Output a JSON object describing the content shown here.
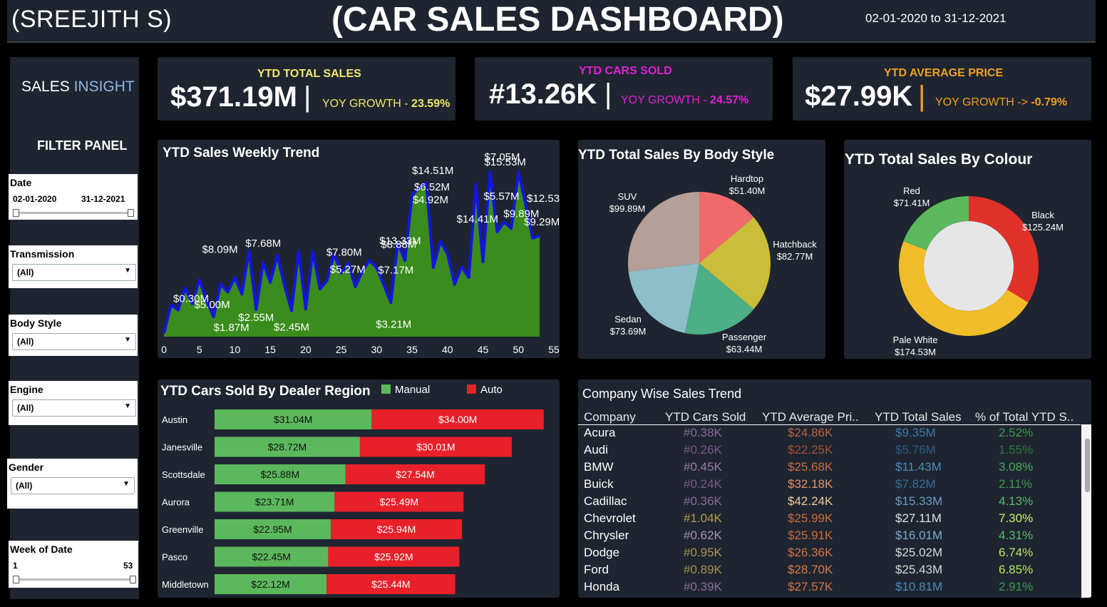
{
  "header": {
    "author": "(SREEJITH S)",
    "title": "(CAR SALES DASHBOARD)",
    "date_range": "02-01-2020 to 31-12-2021"
  },
  "sidebar": {
    "sales_word": "SALES",
    "insight_word": "INSIGHT",
    "filter_title": "FILTER PANEL",
    "filters": {
      "date": {
        "label": "Date",
        "from": "02-01-2020",
        "to": "31-12-2021"
      },
      "transmission": {
        "label": "Transmission",
        "value": "(All)"
      },
      "body_style": {
        "label": "Body Style",
        "value": "(All)"
      },
      "engine": {
        "label": "Engine",
        "value": "(All)"
      },
      "gender": {
        "label": "Gender",
        "value": "(All)"
      },
      "week": {
        "label": "Week of Date",
        "from": "1",
        "to": "53"
      }
    }
  },
  "kpis": [
    {
      "label": "YTD TOTAL SALES",
      "value": "$371.19M",
      "growth_label": "YOY GROWTH -",
      "growth_value": "23.59%",
      "color": "#f2e76b"
    },
    {
      "label": "YTD CARS SOLD",
      "value": "#13.26K",
      "growth_label": "YOY GROWTH -",
      "growth_value": "24.57%",
      "color": "#e020d8"
    },
    {
      "label": "YTD AVERAGE PRICE",
      "value": "$27.99K",
      "growth_label": "YOY GROWTH ->",
      "growth_value": "-0.79%",
      "color": "#f0a020"
    }
  ],
  "weekly_trend": {
    "title": "YTD Sales Weekly Trend",
    "x_ticks": [
      "0",
      "5",
      "10",
      "15",
      "20",
      "25",
      "30",
      "35",
      "40",
      "45",
      "50",
      "55"
    ],
    "labels": [
      {
        "text": "$0.30M",
        "week": 1
      },
      {
        "text": "$1.87M",
        "week": 7
      },
      {
        "text": "$5.00M",
        "week": 7
      },
      {
        "text": "$8.09M",
        "week": 8
      },
      {
        "text": "$2.55M",
        "week": 13
      },
      {
        "text": "$7.68M",
        "week": 14
      },
      {
        "text": "$2.45M",
        "week": 18
      },
      {
        "text": "$5.27M",
        "week": 23
      },
      {
        "text": "$7.80M",
        "week": 23
      },
      {
        "text": "$3.21M",
        "week": 32
      },
      {
        "text": "$7.17M",
        "week": 32
      },
      {
        "text": "$8.88M",
        "week": 32
      },
      {
        "text": "$13.33M",
        "week": 32
      },
      {
        "text": "$14.51M",
        "week": 37
      },
      {
        "text": "$6.52M",
        "week": 37
      },
      {
        "text": "$4.92M",
        "week": 37
      },
      {
        "text": "$14.41M",
        "week": 43
      },
      {
        "text": "$7.05M",
        "week": 46
      },
      {
        "text": "$5.57M",
        "week": 46
      },
      {
        "text": "$15.53M",
        "week": 46
      },
      {
        "text": "$9.89M",
        "week": 48
      },
      {
        "text": "$12.53M",
        "week": 52
      },
      {
        "text": "$9.29M",
        "week": 52
      }
    ]
  },
  "chart_data": [
    {
      "type": "area",
      "title": "YTD Sales Weekly Trend",
      "x": [
        0,
        1,
        2,
        3,
        4,
        5,
        6,
        7,
        8,
        9,
        10,
        11,
        12,
        13,
        14,
        15,
        16,
        17,
        18,
        19,
        20,
        21,
        22,
        23,
        24,
        25,
        26,
        27,
        28,
        29,
        30,
        31,
        32,
        33,
        34,
        35,
        36,
        37,
        38,
        39,
        40,
        41,
        42,
        43,
        44,
        45,
        46,
        47,
        48,
        49,
        50,
        51,
        52,
        53
      ],
      "values": [
        0.3,
        3.0,
        2.5,
        4.6,
        3.1,
        5.4,
        3.4,
        1.87,
        5.0,
        4.2,
        5.6,
        4.0,
        8.09,
        2.55,
        7.0,
        5.1,
        7.68,
        4.8,
        2.45,
        8.1,
        2.6,
        8.0,
        4.5,
        5.27,
        7.8,
        6.0,
        6.9,
        4.7,
        6.2,
        7.17,
        6.5,
        4.9,
        3.21,
        8.88,
        7.17,
        13.33,
        14.0,
        14.51,
        6.52,
        9.0,
        7.8,
        4.92,
        6.6,
        5.57,
        14.41,
        7.05,
        15.53,
        9.89,
        10.8,
        10.2,
        15.53,
        12.53,
        9.29,
        9.5
      ],
      "xlim": [
        0,
        55
      ],
      "ylim": [
        0,
        16
      ],
      "xlabel": "",
      "ylabel": "",
      "color": "#3a8c1c",
      "line_color": "#1414e0"
    },
    {
      "type": "pie",
      "title": "YTD Total Sales By Body Style",
      "categories": [
        "Hardtop",
        "Hatchback",
        "Passenger",
        "Sedan",
        "SUV"
      ],
      "values": [
        51.4,
        82.77,
        63.44,
        73.69,
        99.89
      ],
      "labels": [
        "$51.40M",
        "$82.77M",
        "$63.44M",
        "$73.69M",
        "$99.89M"
      ],
      "colors": [
        "#ef6b6b",
        "#c9bd3a",
        "#4caf86",
        "#8dbfca",
        "#b59f96"
      ]
    },
    {
      "type": "pie",
      "title": "YTD Total Sales By Colour",
      "categories": [
        "Black",
        "Pale White",
        "Red"
      ],
      "values": [
        125.24,
        174.53,
        71.41
      ],
      "labels": [
        "$125.24M",
        "$174.53M",
        "$71.41M"
      ],
      "colors": [
        "#e0302a",
        "#f0bd28",
        "#5cb85c"
      ]
    },
    {
      "type": "bar",
      "title": "YTD Cars Sold By Dealer Region",
      "categories": [
        "Austin",
        "Janesville",
        "Scottsdale",
        "Aurora",
        "Greenville",
        "Pasco",
        "Middletown"
      ],
      "series": [
        {
          "name": "Manual",
          "values": [
            31.04,
            28.72,
            25.88,
            23.71,
            22.95,
            22.45,
            22.12
          ],
          "labels": [
            "$31.04M",
            "$28.72M",
            "$25.88M",
            "$23.71M",
            "$22.95M",
            "$22.45M",
            "$22.12M"
          ],
          "color": "#5cb85c"
        },
        {
          "name": "Auto",
          "values": [
            34.0,
            30.01,
            27.54,
            25.49,
            25.94,
            25.92,
            25.44
          ],
          "labels": [
            "$34.00M",
            "$30.01M",
            "$27.54M",
            "$25.49M",
            "$25.94M",
            "$25.92M",
            "$25.44M"
          ],
          "color": "#e8202a"
        }
      ]
    }
  ],
  "company_table": {
    "title": "Company Wise Sales Trend",
    "columns": [
      "Company",
      "YTD Cars Sold",
      "YTD Average Pri..",
      "YTD Total Sales",
      "% of Total YTD S.."
    ],
    "rows": [
      {
        "company": "Acura",
        "sold": "#0.38K",
        "avg": "$24.86K",
        "total": "$9.35M",
        "pct": "2.52%",
        "c_sold": "#8a6a9a",
        "c_avg": "#c06038",
        "c_total": "#3d7aa8",
        "c_pct": "#3a9a4a"
      },
      {
        "company": "Audi",
        "sold": "#0.26K",
        "avg": "$22.25K",
        "total": "$5.76M",
        "pct": "1.55%",
        "c_sold": "#7a5a8a",
        "c_avg": "#a85030",
        "c_total": "#2d5a88",
        "c_pct": "#2a7a3a"
      },
      {
        "company": "BMW",
        "sold": "#0.45K",
        "avg": "$25.68K",
        "total": "$11.43M",
        "pct": "3.08%",
        "c_sold": "#9a78aa",
        "c_avg": "#d06838",
        "c_total": "#4a8ab8",
        "c_pct": "#4aaa5a"
      },
      {
        "company": "Buick",
        "sold": "#0.24K",
        "avg": "$32.18K",
        "total": "$7.82M",
        "pct": "2.11%",
        "c_sold": "#7a5a8a",
        "c_avg": "#e89060",
        "c_total": "#3a6a98",
        "c_pct": "#3a9a4a"
      },
      {
        "company": "Cadillac",
        "sold": "#0.36K",
        "avg": "$42.24K",
        "total": "$15.33M",
        "pct": "4.13%",
        "c_sold": "#8a6a9a",
        "c_avg": "#f0c890",
        "c_total": "#6a9ac0",
        "c_pct": "#5aba6a"
      },
      {
        "company": "Chevrolet",
        "sold": "#1.04K",
        "avg": "$25.99K",
        "total": "$27.11M",
        "pct": "7.30%",
        "c_sold": "#b89a50",
        "c_avg": "#d06838",
        "c_total": "#e0e0e0",
        "c_pct": "#c8f070"
      },
      {
        "company": "Chrysler",
        "sold": "#0.62K",
        "avg": "$25.91K",
        "total": "$16.01M",
        "pct": "4.31%",
        "c_sold": "#a890b8",
        "c_avg": "#d06838",
        "c_total": "#7aaac8",
        "c_pct": "#5aba6a"
      },
      {
        "company": "Dodge",
        "sold": "#0.95K",
        "avg": "$26.36K",
        "total": "$25.02M",
        "pct": "6.74%",
        "c_sold": "#a89850",
        "c_avg": "#d87040",
        "c_total": "#d8d8d8",
        "c_pct": "#b8e860"
      },
      {
        "company": "Ford",
        "sold": "#0.89K",
        "avg": "$28.70K",
        "total": "$25.43M",
        "pct": "6.85%",
        "c_sold": "#a89050",
        "c_avg": "#e07840",
        "c_total": "#d8d8d8",
        "c_pct": "#b8e860"
      },
      {
        "company": "Honda",
        "sold": "#0.39K",
        "avg": "$27.57K",
        "total": "$10.81M",
        "pct": "2.91%",
        "c_sold": "#8a6a9a",
        "c_avg": "#d87040",
        "c_total": "#4a8ab8",
        "c_pct": "#3a9a4a"
      }
    ]
  }
}
